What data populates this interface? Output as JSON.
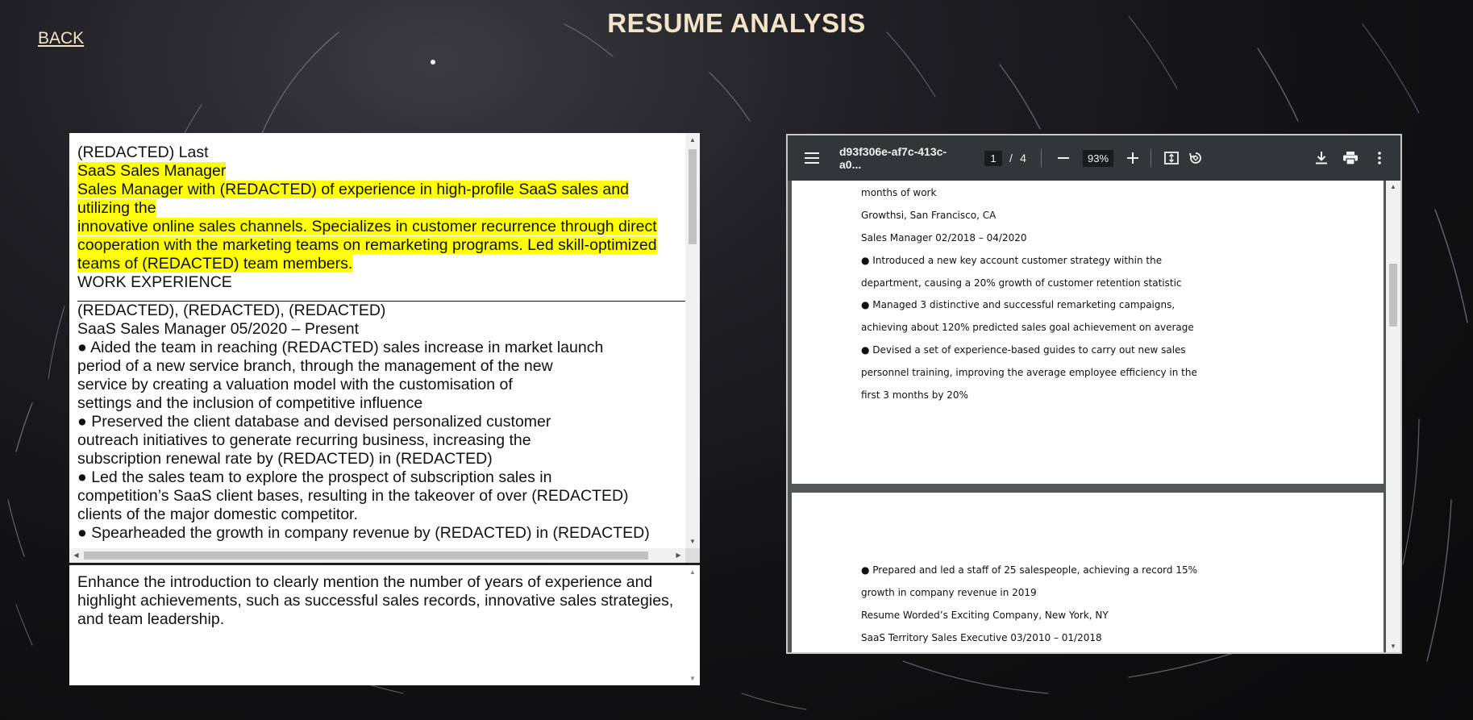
{
  "header": {
    "back_label": "BACK",
    "title": "RESUME ANALYSIS"
  },
  "resume": {
    "lines": [
      {
        "text": "(REDACTED) Last",
        "highlight": false
      },
      {
        "text": "SaaS Sales Manager",
        "highlight": true
      },
      {
        "text": "Sales Manager with (REDACTED) of experience in high-profile SaaS sales and",
        "highlight": true
      },
      {
        "text": "utilizing the",
        "highlight": true
      },
      {
        "text": "innovative online sales channels. Specializes in customer recurrence through direct",
        "highlight": true
      },
      {
        "text": "cooperation with the marketing teams on remarketing programs. Led skill-optimized",
        "highlight": true
      },
      {
        "text": "teams of (REDACTED) team members.",
        "highlight": true
      },
      {
        "text": "WORK EXPERIENCE",
        "highlight": false
      }
    ],
    "lines_after_rule": [
      "(REDACTED), (REDACTED), (REDACTED)",
      "SaaS Sales Manager 05/2020 – Present",
      "● Aided the team in reaching (REDACTED) sales increase in market launch",
      "period of a new service branch, through the management of the new",
      "service by creating a valuation model with the customisation of",
      "settings and the inclusion of competitive influence",
      "● Preserved the client database and devised personalized customer",
      "outreach initiatives to generate recurring business, increasing the",
      "subscription renewal rate by (REDACTED) in (REDACTED)",
      "● Led the sales team to explore the prospect of subscription sales in",
      "competition’s SaaS client bases, resulting in the takeover of over (REDACTED)",
      "clients of the major domestic competitor.",
      "● Spearheaded the growth in company revenue by (REDACTED) in (REDACTED)"
    ]
  },
  "feedback": {
    "text": "Enhance the introduction to clearly mention the number of years of experience and highlight achievements, such as successful sales records, innovative sales strategies, and team leadership."
  },
  "pdf": {
    "filename": "d93f306e-af7c-413c-a0...",
    "current_page": "1",
    "page_separator": "/",
    "total_pages": "4",
    "zoom": "93%",
    "page1_lines": [
      "months of work",
      "Growthsi, San Francisco, CA",
      "Sales Manager 02/2018 – 04/2020",
      "● Introduced a new key account customer strategy within the",
      "department, causing a 20% growth of customer retention statistic",
      "● Managed 3 distinctive and successful remarketing campaigns,",
      "achieving about 120% predicted sales goal achievement on average",
      "● Devised a set of experience-based guides to carry out new sales",
      "personnel training, improving the average employee efficiency in the",
      "first 3 months by 20%"
    ],
    "page2_lines": [
      "● Prepared and led a staff of 25 salespeople, achieving a record 15%",
      "growth in company revenue in 2019",
      "Resume Worded’s Exciting Company, New York, NY",
      "SaaS Territory Sales Executive 03/2010 – 01/2018"
    ]
  },
  "colors": {
    "highlight": "#ffff00",
    "title_text": "#f3e3c8",
    "pdf_toolbar": "#323639",
    "pdf_background": "#525659"
  },
  "icons": [
    "menu-icon",
    "zoom-out-icon",
    "zoom-in-icon",
    "fit-page-icon",
    "rotate-icon",
    "download-icon",
    "print-icon",
    "more-vert-icon"
  ]
}
